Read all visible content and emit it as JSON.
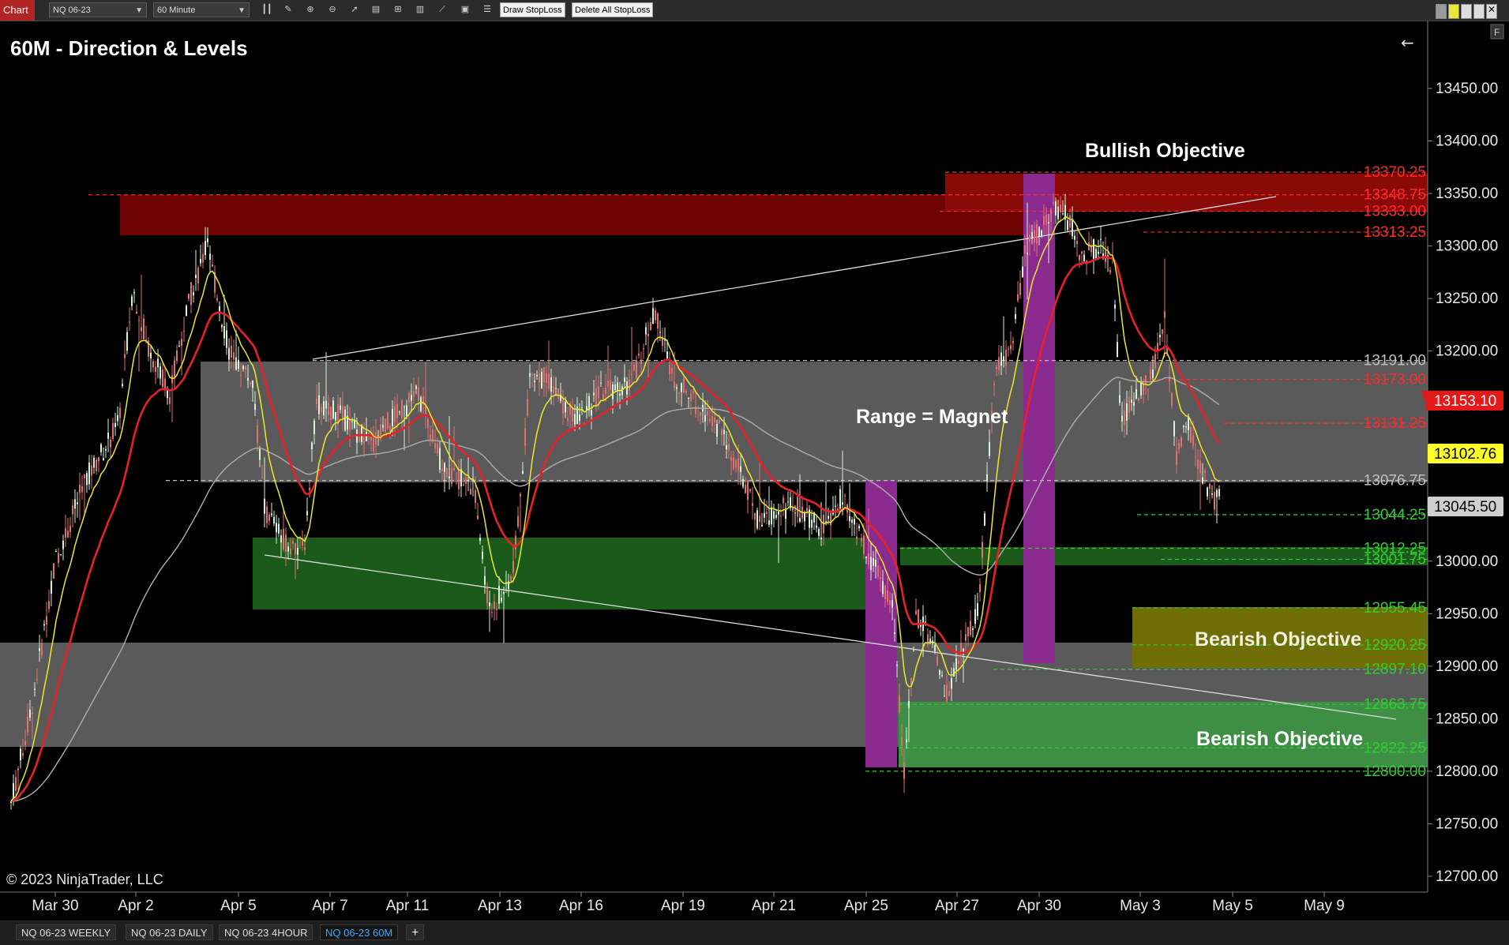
{
  "toolbar": {
    "chart_label": "Chart",
    "instrument": "NQ 06-23",
    "interval": "60 Minute",
    "draw_stoploss": "Draw StopLoss",
    "delete_stoploss": "Delete All StopLoss",
    "tools": [
      "bar-style-icon",
      "draw-line-icon",
      "zoom-in-icon",
      "zoom-out-icon",
      "pointer-icon",
      "data-box-icon",
      "split-icon",
      "chart-style-icon",
      "indicators-icon",
      "strategy-icon",
      "properties-icon"
    ]
  },
  "chart": {
    "title": "60M - Direction & Levels",
    "copyright": "© 2023 NinjaTrader, LLC",
    "back_arrow": "←",
    "corner_label": "F",
    "annotations": {
      "bullish": "Bullish Objective",
      "range": "Range = Magnet",
      "bearish1": "Bearish Objective",
      "bearish2": "Bearish Objective"
    },
    "price_axis": [
      "13450.00",
      "13400.00",
      "13350.00",
      "13300.00",
      "13250.00",
      "13200.00",
      "13150.00",
      "13100.00",
      "13050.00",
      "13000.00",
      "12950.00",
      "12900.00",
      "12850.00",
      "12800.00",
      "12750.00",
      "12700.00"
    ],
    "x_axis": [
      "Mar 30",
      "Apr 2",
      "Apr 5",
      "Apr 7",
      "Apr 11",
      "Apr 13",
      "Apr 16",
      "Apr 19",
      "Apr 21",
      "Apr 25",
      "Apr 27",
      "Apr 30",
      "May 3",
      "May 5",
      "May 9"
    ],
    "current_price": "13153.10",
    "marker_yellow": "13102.76",
    "marker_gray": "13045.50",
    "levels": [
      {
        "label": "13370.25",
        "value": 13370.25,
        "color": "#ff2a2a"
      },
      {
        "label": "13348.75",
        "value": 13348.75,
        "color": "#ff2a2a"
      },
      {
        "label": "13333.00",
        "value": 13333.0,
        "color": "#ff2a2a"
      },
      {
        "label": "13313.25",
        "value": 13313.25,
        "color": "#ff2a2a"
      },
      {
        "label": "13191.00",
        "value": 13191.0,
        "color": "#bfbfbf"
      },
      {
        "label": "13173.00",
        "value": 13173.0,
        "color": "#ff2a2a"
      },
      {
        "label": "13131.25",
        "value": 13131.25,
        "color": "#ff2a2a"
      },
      {
        "label": "13076.75",
        "value": 13076.75,
        "color": "#bfbfbf"
      },
      {
        "label": "13044.25",
        "value": 13044.25,
        "color": "#33cc33"
      },
      {
        "label": "13012.25",
        "value": 13012.25,
        "color": "#33cc33"
      },
      {
        "label": "13001.75",
        "value": 13001.75,
        "color": "#33cc33"
      },
      {
        "label": "12955.45",
        "value": 12955.45,
        "color": "#33cc33"
      },
      {
        "label": "12920.25",
        "value": 12920.25,
        "color": "#33cc33"
      },
      {
        "label": "12897.10",
        "value": 12897.1,
        "color": "#33cc33"
      },
      {
        "label": "12863.75",
        "value": 12863.75,
        "color": "#33cc33"
      },
      {
        "label": "12822.25",
        "value": 12822.25,
        "color": "#33cc33"
      },
      {
        "label": "12800.00",
        "value": 12800.0,
        "color": "#33cc33"
      }
    ],
    "colors": {
      "fast_ma": "#e9e92a",
      "slow_ma": "#e8202a",
      "long_ma": "#a8a8a8",
      "up": "#d8f0d8",
      "down": "#e07070"
    }
  },
  "bottom_tabs": [
    {
      "label": "NQ 06-23 WEEKLY",
      "active": false
    },
    {
      "label": "NQ 06-23 DAILY",
      "active": false
    },
    {
      "label": "NQ 06-23 4HOUR",
      "active": false
    },
    {
      "label": "NQ 06-23 60M",
      "active": true
    }
  ],
  "add_tab": "+"
}
